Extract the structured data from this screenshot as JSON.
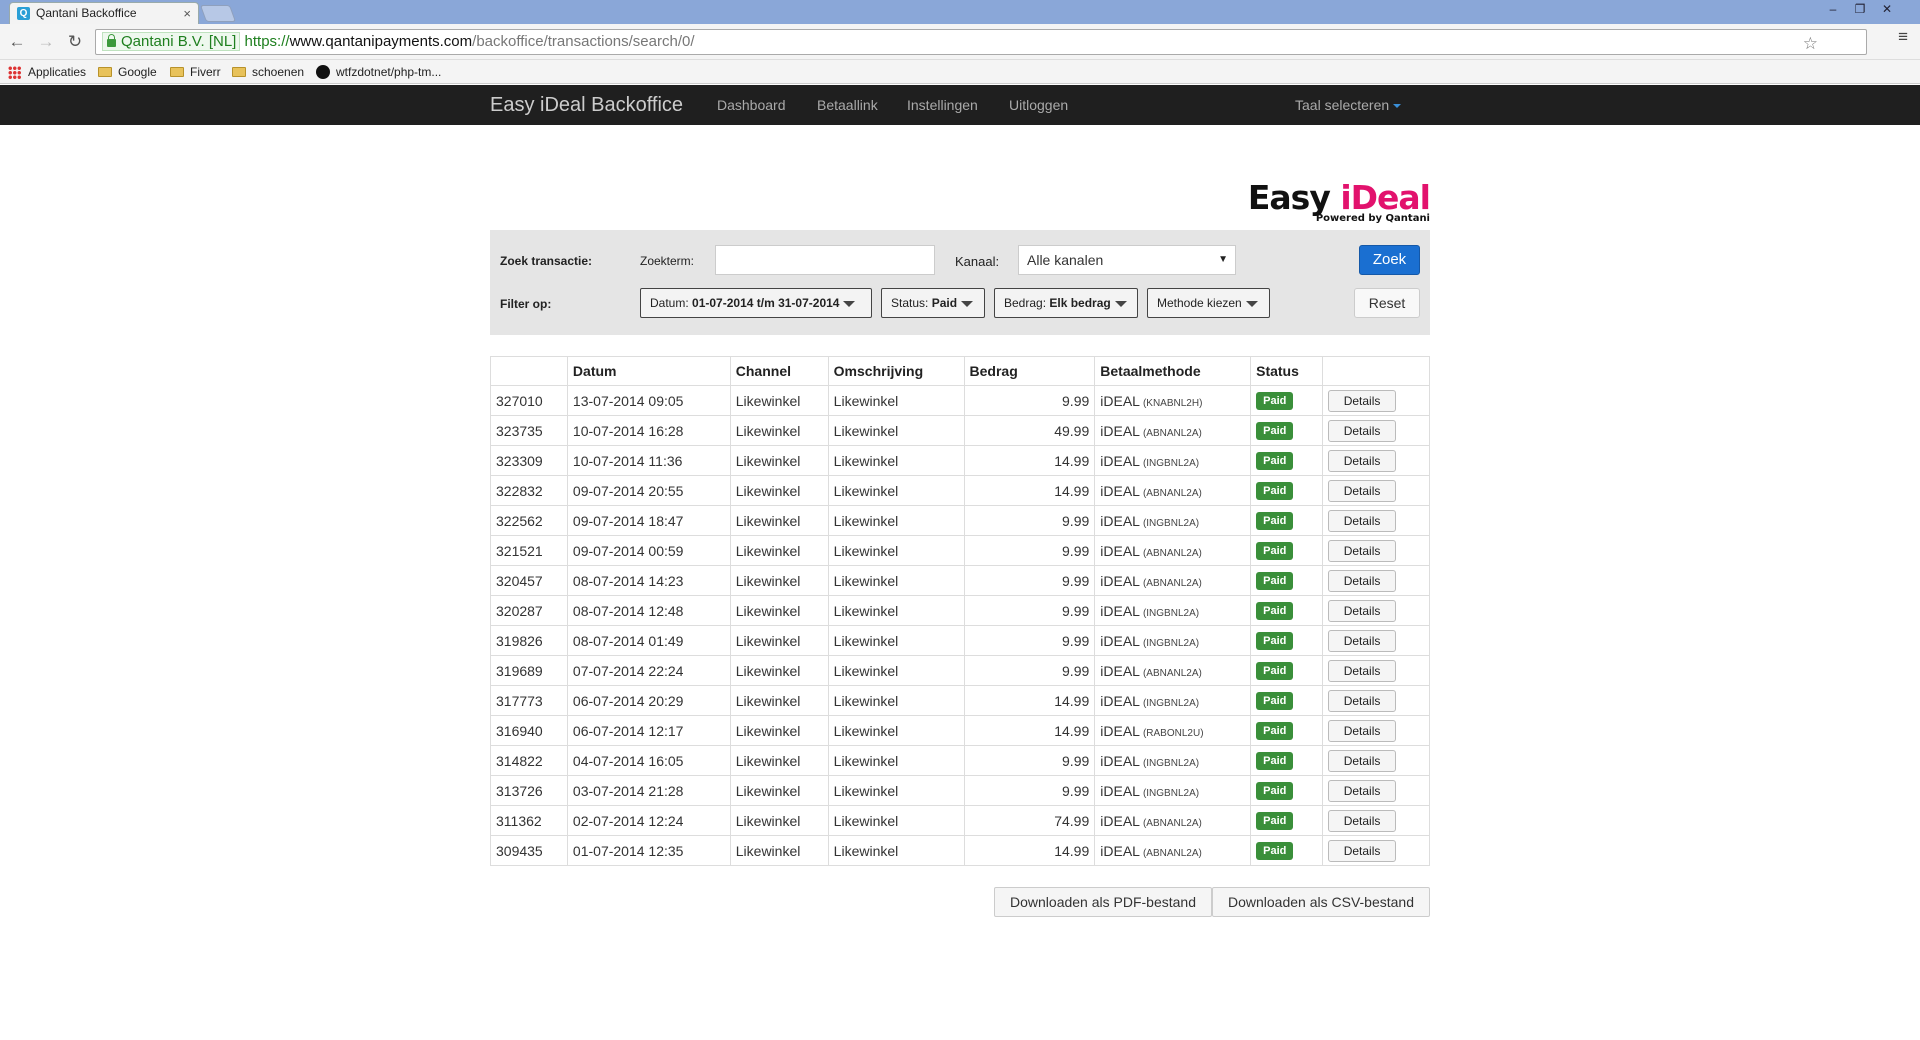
{
  "browser": {
    "tab_title": "Qantani Backoffice",
    "tab_favicon_letter": "Q",
    "ev_label": "Qantani B.V. [NL]",
    "url_scheme": "https://",
    "url_host": "www.qantanipayments.com",
    "url_path": "/backoffice/transactions/search/0/",
    "bookmarks": [
      "Applicaties",
      "Google",
      "Fiverr",
      "schoenen",
      "wtfzdotnet/php-tm..."
    ]
  },
  "navbar": {
    "brand": "Easy iDeal Backoffice",
    "links": [
      "Dashboard",
      "Betaallink",
      "Instellingen",
      "Uitloggen"
    ],
    "language": "Taal selecteren"
  },
  "logo": {
    "part1": "Easy ",
    "part2": "iDeal",
    "sub": "Powered by Qantani",
    "accent_color": "#e2126d"
  },
  "search": {
    "label": "Zoek transactie:",
    "term_label": "Zoekterm:",
    "term_value": "",
    "channel_label": "Kanaal:",
    "channel_value": "Alle kanalen",
    "submit": "Zoek",
    "filter_label": "Filter op:",
    "filters": {
      "date_prefix": "Datum:",
      "date_value": "01-07-2014 t/m 31-07-2014",
      "status_prefix": "Status:",
      "status_value": "Paid",
      "amount_prefix": "Bedrag:",
      "amount_value": "Elk bedrag",
      "method": "Methode kiezen"
    },
    "reset": "Reset"
  },
  "table": {
    "headers": [
      "",
      "Datum",
      "Channel",
      "Omschrijving",
      "Bedrag",
      "Betaalmethode",
      "Status",
      ""
    ],
    "status_color": "#3a8f3a",
    "rows": [
      {
        "id": "327010",
        "date": "13-07-2014 09:05",
        "channel": "Likewinkel",
        "desc": "Likewinkel",
        "amount": "9.99",
        "method": "iDEAL",
        "bank": "(KNABNL2H)",
        "status": "Paid",
        "action": "Details"
      },
      {
        "id": "323735",
        "date": "10-07-2014 16:28",
        "channel": "Likewinkel",
        "desc": "Likewinkel",
        "amount": "49.99",
        "method": "iDEAL",
        "bank": "(ABNANL2A)",
        "status": "Paid",
        "action": "Details"
      },
      {
        "id": "323309",
        "date": "10-07-2014 11:36",
        "channel": "Likewinkel",
        "desc": "Likewinkel",
        "amount": "14.99",
        "method": "iDEAL",
        "bank": "(INGBNL2A)",
        "status": "Paid",
        "action": "Details"
      },
      {
        "id": "322832",
        "date": "09-07-2014 20:55",
        "channel": "Likewinkel",
        "desc": "Likewinkel",
        "amount": "14.99",
        "method": "iDEAL",
        "bank": "(ABNANL2A)",
        "status": "Paid",
        "action": "Details"
      },
      {
        "id": "322562",
        "date": "09-07-2014 18:47",
        "channel": "Likewinkel",
        "desc": "Likewinkel",
        "amount": "9.99",
        "method": "iDEAL",
        "bank": "(INGBNL2A)",
        "status": "Paid",
        "action": "Details"
      },
      {
        "id": "321521",
        "date": "09-07-2014 00:59",
        "channel": "Likewinkel",
        "desc": "Likewinkel",
        "amount": "9.99",
        "method": "iDEAL",
        "bank": "(ABNANL2A)",
        "status": "Paid",
        "action": "Details"
      },
      {
        "id": "320457",
        "date": "08-07-2014 14:23",
        "channel": "Likewinkel",
        "desc": "Likewinkel",
        "amount": "9.99",
        "method": "iDEAL",
        "bank": "(ABNANL2A)",
        "status": "Paid",
        "action": "Details"
      },
      {
        "id": "320287",
        "date": "08-07-2014 12:48",
        "channel": "Likewinkel",
        "desc": "Likewinkel",
        "amount": "9.99",
        "method": "iDEAL",
        "bank": "(INGBNL2A)",
        "status": "Paid",
        "action": "Details"
      },
      {
        "id": "319826",
        "date": "08-07-2014 01:49",
        "channel": "Likewinkel",
        "desc": "Likewinkel",
        "amount": "9.99",
        "method": "iDEAL",
        "bank": "(INGBNL2A)",
        "status": "Paid",
        "action": "Details"
      },
      {
        "id": "319689",
        "date": "07-07-2014 22:24",
        "channel": "Likewinkel",
        "desc": "Likewinkel",
        "amount": "9.99",
        "method": "iDEAL",
        "bank": "(ABNANL2A)",
        "status": "Paid",
        "action": "Details"
      },
      {
        "id": "317773",
        "date": "06-07-2014 20:29",
        "channel": "Likewinkel",
        "desc": "Likewinkel",
        "amount": "14.99",
        "method": "iDEAL",
        "bank": "(INGBNL2A)",
        "status": "Paid",
        "action": "Details"
      },
      {
        "id": "316940",
        "date": "06-07-2014 12:17",
        "channel": "Likewinkel",
        "desc": "Likewinkel",
        "amount": "14.99",
        "method": "iDEAL",
        "bank": "(RABONL2U)",
        "status": "Paid",
        "action": "Details"
      },
      {
        "id": "314822",
        "date": "04-07-2014 16:05",
        "channel": "Likewinkel",
        "desc": "Likewinkel",
        "amount": "9.99",
        "method": "iDEAL",
        "bank": "(INGBNL2A)",
        "status": "Paid",
        "action": "Details"
      },
      {
        "id": "313726",
        "date": "03-07-2014 21:28",
        "channel": "Likewinkel",
        "desc": "Likewinkel",
        "amount": "9.99",
        "method": "iDEAL",
        "bank": "(INGBNL2A)",
        "status": "Paid",
        "action": "Details"
      },
      {
        "id": "311362",
        "date": "02-07-2014 12:24",
        "channel": "Likewinkel",
        "desc": "Likewinkel",
        "amount": "74.99",
        "method": "iDEAL",
        "bank": "(ABNANL2A)",
        "status": "Paid",
        "action": "Details"
      },
      {
        "id": "309435",
        "date": "01-07-2014 12:35",
        "channel": "Likewinkel",
        "desc": "Likewinkel",
        "amount": "14.99",
        "method": "iDEAL",
        "bank": "(ABNANL2A)",
        "status": "Paid",
        "action": "Details"
      }
    ]
  },
  "downloads": {
    "pdf": "Downloaden als PDF-bestand",
    "csv": "Downloaden als CSV-bestand"
  }
}
